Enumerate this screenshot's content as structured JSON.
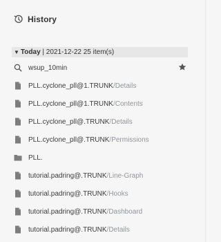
{
  "header": {
    "title": "History",
    "icon": "history-icon"
  },
  "group": {
    "label": "Today",
    "date": "2021-12-22",
    "count_text": "25 item(s)"
  },
  "search": {
    "query": "wsup_10min"
  },
  "items": [
    {
      "icon": "file-icon",
      "name": "PLL.cyclone_pll@1.TRUNK",
      "sep": " / ",
      "sub": "Details"
    },
    {
      "icon": "file-icon",
      "name": "PLL.cyclone_pll@1.TRUNK",
      "sep": " / ",
      "sub": "Contents"
    },
    {
      "icon": "file-icon",
      "name": "PLL.cyclone_pll@.TRUNK",
      "sep": " / ",
      "sub": "Details"
    },
    {
      "icon": "file-icon",
      "name": "PLL.cyclone_pll@.TRUNK",
      "sep": " / ",
      "sub": "Permissions"
    },
    {
      "icon": "folder-icon",
      "name": "PLL.",
      "sep": "",
      "sub": ""
    },
    {
      "icon": "file-icon",
      "name": "tutorial.padring@.TRUNK",
      "sep": " / ",
      "sub": "Line-Graph"
    },
    {
      "icon": "file-icon",
      "name": "tutorial.padring@.TRUNK",
      "sep": " / ",
      "sub": "Hooks"
    },
    {
      "icon": "file-icon",
      "name": "tutorial.padring@.TRUNK",
      "sep": " / ",
      "sub": "Dashboard"
    },
    {
      "icon": "file-icon",
      "name": "tutorial.padring@.TRUNK",
      "sep": " / ",
      "sub": "Details"
    }
  ]
}
